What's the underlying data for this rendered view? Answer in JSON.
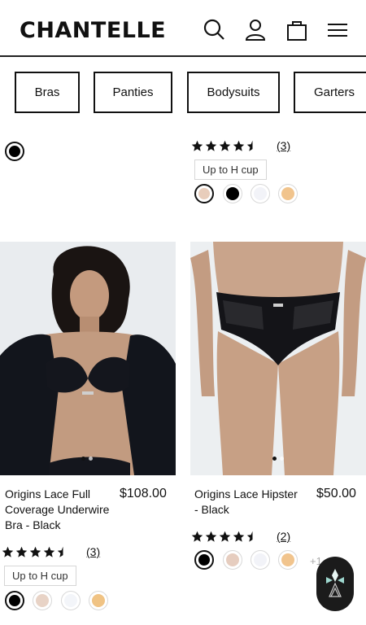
{
  "header": {
    "logo": "CHANTELLE",
    "icons": [
      "search-icon",
      "account-icon",
      "bag-icon",
      "menu-icon"
    ]
  },
  "categories": [
    {
      "label": "Bras"
    },
    {
      "label": "Panties"
    },
    {
      "label": "Bodysuits"
    },
    {
      "label": "Garters"
    }
  ],
  "top_row": {
    "left": {
      "swatches": [
        "#000000"
      ]
    },
    "right": {
      "rating": 4.5,
      "reviews": "(3)",
      "badge": "Up to H cup",
      "swatches": [
        "#e8cdbb",
        "#000000",
        "#f2f3f8",
        "#f1c48d"
      ]
    }
  },
  "products": [
    {
      "name": "Origins Lace Full Coverage Underwire Bra - Black",
      "name_lines": [
        "Origins Lace Full",
        "Coverage Underwire",
        "Bra - Black"
      ],
      "price": "$108.00",
      "rating": 4.5,
      "reviews": "(3)",
      "badge": "Up to H cup",
      "swatches": [
        "#000000",
        "#e8d3c6",
        "#f3f5f9",
        "#f0c384"
      ]
    },
    {
      "name": "Origins Lace Hipster - Black",
      "name_lines": [
        "Origins Lace Hipster",
        "- Black"
      ],
      "price": "$50.00",
      "rating": 4.5,
      "reviews": "(2)",
      "swatches": [
        "#000000",
        "#e6cdbf",
        "#f2f3f8",
        "#f1c48d"
      ],
      "more_colors": "+1"
    }
  ],
  "colors": {
    "text": "#111111",
    "border": "#111111",
    "chat_bubble": "#1b1b1b"
  }
}
